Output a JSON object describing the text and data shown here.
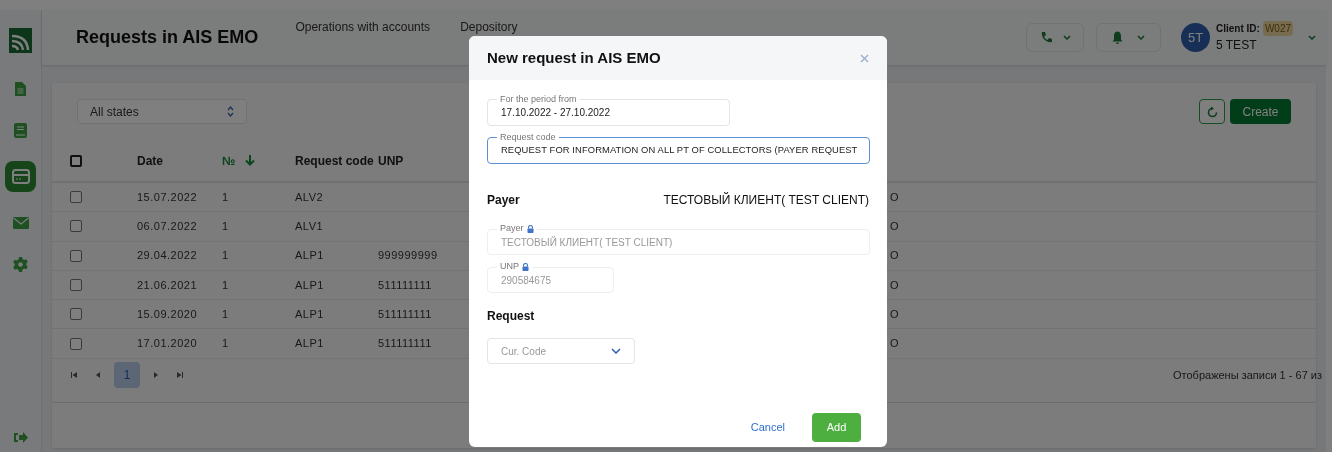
{
  "sidebar": {
    "items": [
      {
        "kind": "document",
        "selected": false
      },
      {
        "kind": "book",
        "selected": false
      },
      {
        "kind": "card",
        "selected": true
      },
      {
        "kind": "mail",
        "selected": false
      },
      {
        "kind": "settings",
        "selected": false
      }
    ]
  },
  "header": {
    "title": "Requests in AIS EMO",
    "nav": [
      "Operations with accounts",
      "Depository"
    ],
    "user": {
      "avatar": "5T",
      "client_id_label": "Client ID:",
      "client_id": "W027",
      "name": "5 TEST"
    }
  },
  "toolbar": {
    "state_filter": "All states",
    "create": "Create"
  },
  "table": {
    "header_checked": false,
    "columns": [
      {
        "label": "Date",
        "sorted": false
      },
      {
        "label": "№",
        "sorted": true
      },
      {
        "label": "Request code",
        "sorted": false
      },
      {
        "label": "UNP",
        "sorted": false
      }
    ],
    "rows": [
      {
        "checked": false,
        "date": "15.07.2022",
        "number": "1",
        "code": "ALV2",
        "unp": "",
        "column_5": "O"
      },
      {
        "checked": false,
        "date": "06.07.2022",
        "number": "1",
        "code": "ALV1",
        "unp": "",
        "column_5": "O"
      },
      {
        "checked": false,
        "date": "29.04.2022",
        "number": "1",
        "code": "ALP1",
        "unp": "999999999",
        "column_5": "O"
      },
      {
        "checked": false,
        "date": "21.06.2021",
        "number": "1",
        "code": "ALP1",
        "unp": "511111111",
        "column_5": "O"
      },
      {
        "checked": false,
        "date": "15.09.2020",
        "number": "1",
        "code": "ALP1",
        "unp": "511111111",
        "column_5": "O"
      },
      {
        "checked": false,
        "date": "17.01.2020",
        "number": "1",
        "code": "ALP1",
        "unp": "511111111",
        "column_5": "O"
      }
    ]
  },
  "pagination": {
    "pages": [
      {
        "label": "1",
        "selected": true
      }
    ],
    "summary": "Отображены записи 1 - 67 из"
  },
  "modal": {
    "title": "New request in AIS EMO",
    "period": {
      "label": "For the period from",
      "value": "17.10.2022 - 27.10.2022"
    },
    "request_code": {
      "label": "Request code",
      "value": "REQUEST FOR INFORMATION ON ALL PT OF COLLECTORS (PAYER REQUEST"
    },
    "payer_section": {
      "title": "Payer",
      "value": "ТЕСТОВЫЙ КЛИЕНТ( TEST CLIENT)"
    },
    "payer_field": {
      "label": "Payer",
      "value": "ТЕСТОВЫЙ КЛИЕНТ( TEST CLIENT)",
      "locked": true
    },
    "unp_field": {
      "label": "UNP",
      "value": "290584675",
      "locked": true
    },
    "request_section": {
      "title": "Request"
    },
    "currency": {
      "placeholder": "Cur. Code"
    },
    "buttons": {
      "cancel": "Cancel",
      "add": "Add"
    }
  }
}
